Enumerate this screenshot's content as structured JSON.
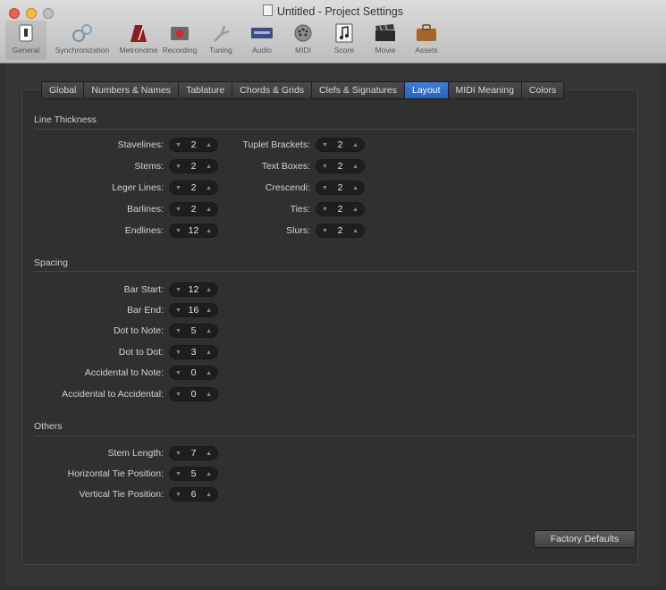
{
  "window": {
    "title": "Untitled - Project Settings"
  },
  "toolbar": [
    {
      "label": "General",
      "icon": "general-icon"
    },
    {
      "label": "Synchronization",
      "icon": "sync-icon"
    },
    {
      "label": "Metronome",
      "icon": "metronome-icon"
    },
    {
      "label": "Recording",
      "icon": "record-icon"
    },
    {
      "label": "Tuning",
      "icon": "tuning-fork-icon"
    },
    {
      "label": "Audio",
      "icon": "audio-icon"
    },
    {
      "label": "MIDI",
      "icon": "midi-icon"
    },
    {
      "label": "Score",
      "icon": "score-icon"
    },
    {
      "label": "Movie",
      "icon": "movie-icon"
    },
    {
      "label": "Assets",
      "icon": "assets-icon"
    }
  ],
  "tabs": [
    "Global",
    "Numbers & Names",
    "Tablature",
    "Chords & Grids",
    "Clefs & Signatures",
    "Layout",
    "MIDI Meaning",
    "Colors"
  ],
  "active_tab": "Layout",
  "sections": {
    "line_thickness": "Line Thickness",
    "spacing": "Spacing",
    "others": "Others"
  },
  "line_thickness_left": [
    {
      "label": "Stavelines:",
      "value": "2"
    },
    {
      "label": "Stems:",
      "value": "2"
    },
    {
      "label": "Leger Lines:",
      "value": "2"
    },
    {
      "label": "Barlines:",
      "value": "2"
    },
    {
      "label": "Endlines:",
      "value": "12"
    }
  ],
  "line_thickness_right": [
    {
      "label": "Tuplet Brackets:",
      "value": "2"
    },
    {
      "label": "Text Boxes:",
      "value": "2"
    },
    {
      "label": "Crescendi:",
      "value": "2"
    },
    {
      "label": "Ties:",
      "value": "2"
    },
    {
      "label": "Slurs:",
      "value": "2"
    }
  ],
  "spacing": [
    {
      "label": "Bar Start:",
      "value": "12"
    },
    {
      "label": "Bar End:",
      "value": "16"
    },
    {
      "label": "Dot to Note:",
      "value": "5"
    },
    {
      "label": "Dot to Dot:",
      "value": "3"
    },
    {
      "label": "Accidental to Note:",
      "value": "0"
    },
    {
      "label": "Accidental to Accidental:",
      "value": "0"
    }
  ],
  "others": [
    {
      "label": "Stem Length:",
      "value": "7"
    },
    {
      "label": "Horizontal Tie Position:",
      "value": "5"
    },
    {
      "label": "Vertical Tie Position:",
      "value": "6"
    }
  ],
  "buttons": {
    "factory_defaults": "Factory Defaults"
  },
  "colors": {
    "accent": "#2f6fd0",
    "background": "#2f2f2f"
  }
}
